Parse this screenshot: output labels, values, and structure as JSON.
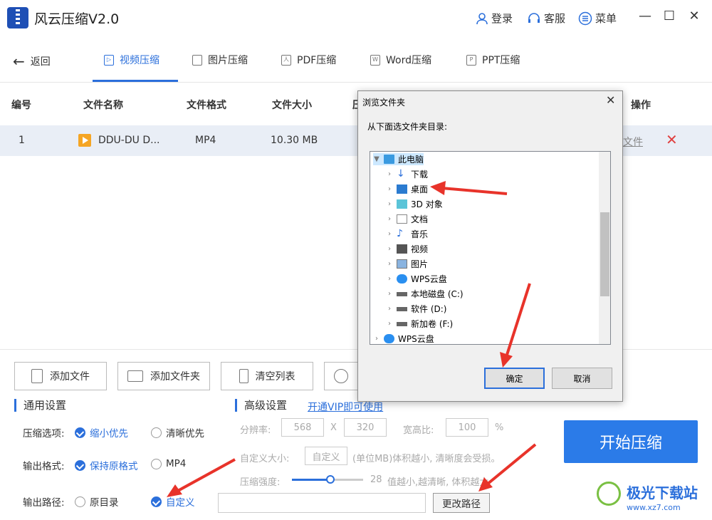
{
  "app": {
    "title": "风云压缩V2.0"
  },
  "titlebar": {
    "login": "登录",
    "service": "客服",
    "menu": "菜单"
  },
  "nav": {
    "back": "返回",
    "tabs": [
      {
        "label": "视频压缩",
        "icon": "video-icon"
      },
      {
        "label": "图片压缩",
        "icon": "image-icon"
      },
      {
        "label": "PDF压缩",
        "icon": "pdf-icon"
      },
      {
        "label": "Word压缩",
        "icon": "word-icon"
      },
      {
        "label": "PPT压缩",
        "icon": "ppt-icon"
      }
    ]
  },
  "table": {
    "headers": {
      "index": "编号",
      "name": "文件名称",
      "format": "文件格式",
      "size": "文件大小",
      "status": "压",
      "ops": "操作"
    },
    "rows": [
      {
        "index": "1",
        "name": "DDU-DU D...",
        "format": "MP4",
        "size": "10.30 MB",
        "op_partial": "文件"
      }
    ]
  },
  "toolbar": {
    "add_file": "添加文件",
    "add_folder": "添加文件夹",
    "clear_list": "清空列表"
  },
  "general": {
    "title": "通用设置",
    "compress_label": "压缩选项:",
    "compress_opt1": "缩小优先",
    "compress_opt2": "清晰优先",
    "format_label": "输出格式:",
    "format_opt1": "保持原格式",
    "format_opt2": "MP4",
    "path_label": "输出路径:",
    "path_opt1": "原目录",
    "path_opt2": "自定义",
    "path_value": "",
    "change_path": "更改路径"
  },
  "advanced": {
    "title": "高级设置",
    "vip_link": "开通VIP即可使用",
    "resolution_label": "分辨率:",
    "res_w": "568",
    "res_x": "X",
    "res_h": "320",
    "ratio_label": "宽高比:",
    "ratio_value": "100",
    "ratio_unit": "%",
    "custom_size_label": "自定义大小:",
    "custom_size_placeholder": "自定义",
    "custom_size_hint": "(单位MB)体积越小, 清晰度会受损。",
    "strength_label": "压缩强度:",
    "strength_value": "28",
    "strength_hint": "值越小,越清晰, 体积越大",
    "strength_fraction": 0.55
  },
  "start_button": "开始压缩",
  "dialog": {
    "title": "浏览文件夹",
    "prompt": "从下面选文件夹目录:",
    "tree": [
      {
        "label": "此电脑",
        "icon": "computer-icon"
      },
      {
        "label": "下载",
        "icon": "download-icon"
      },
      {
        "label": "桌面",
        "icon": "desktop-icon"
      },
      {
        "label": "3D 对象",
        "icon": "3d-object-icon"
      },
      {
        "label": "文档",
        "icon": "document-icon"
      },
      {
        "label": "音乐",
        "icon": "music-icon"
      },
      {
        "label": "视频",
        "icon": "video-folder-icon"
      },
      {
        "label": "图片",
        "icon": "picture-icon"
      },
      {
        "label": "WPS云盘",
        "icon": "cloud-icon"
      },
      {
        "label": "本地磁盘 (C:)",
        "icon": "drive-icon"
      },
      {
        "label": "软件 (D:)",
        "icon": "drive-icon"
      },
      {
        "label": "新加卷 (F:)",
        "icon": "drive-icon"
      },
      {
        "label": "WPS云盘",
        "icon": "cloud-icon"
      }
    ],
    "ok": "确定",
    "cancel": "取消"
  },
  "watermark": {
    "name": "极光下载站",
    "url": "www.xz7.com"
  }
}
